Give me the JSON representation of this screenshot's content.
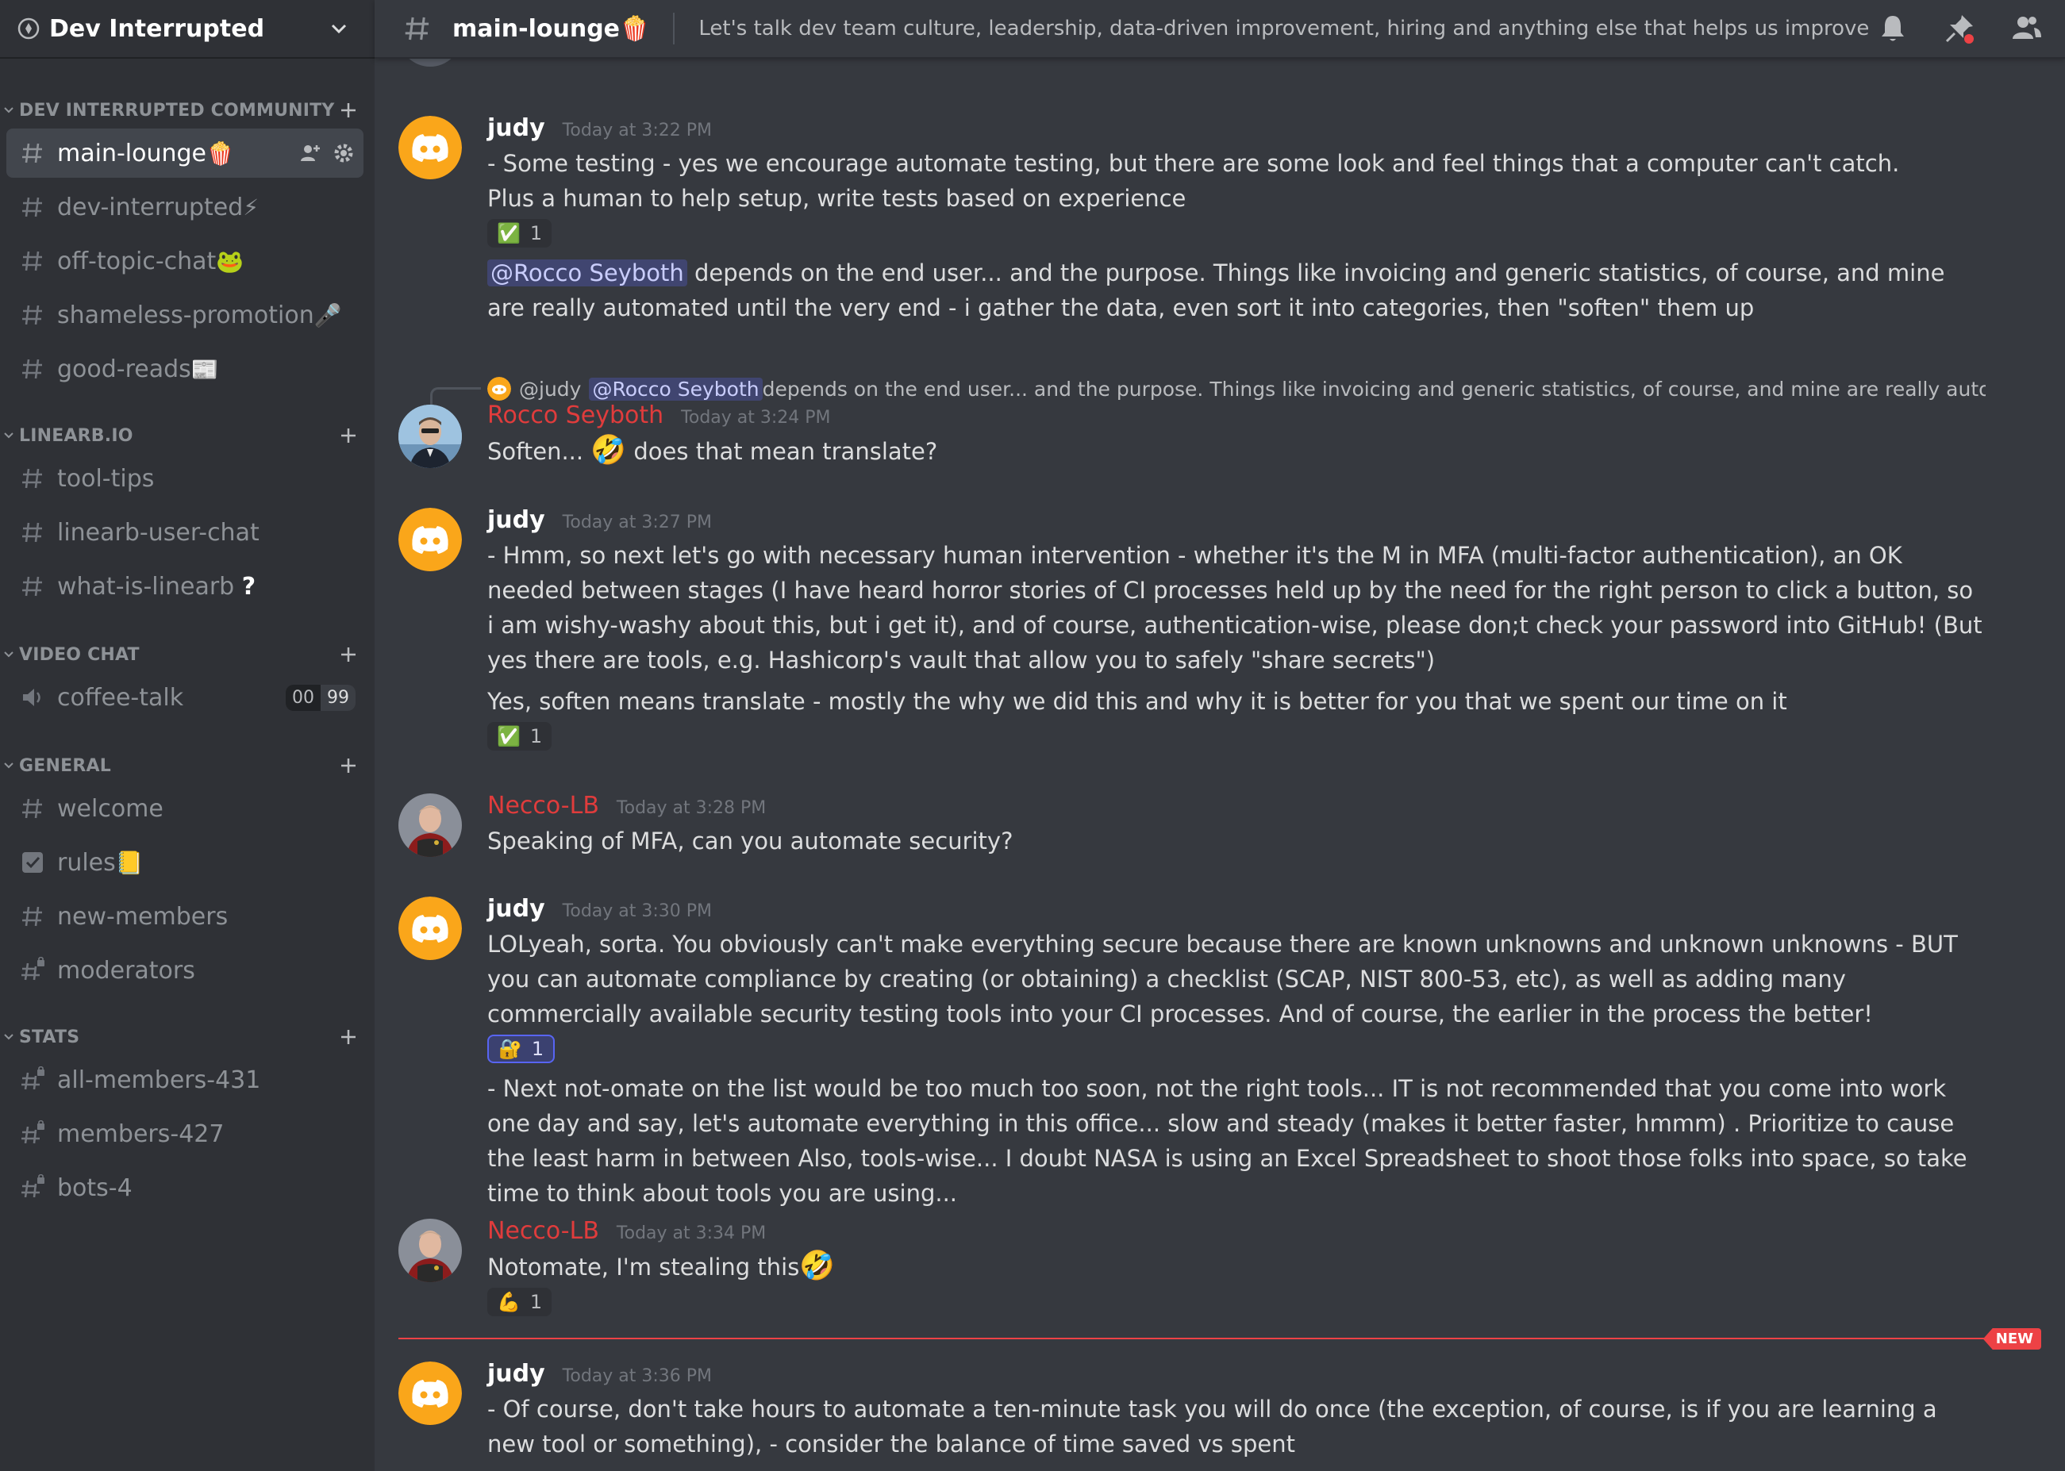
{
  "server": {
    "name": "Dev Interrupted"
  },
  "sidebar": {
    "categories": [
      {
        "name": "DEV INTERRUPTED COMMUNITY",
        "channels": [
          {
            "name": "main-lounge",
            "emoji": "🍿"
          },
          {
            "name": "dev-interrupted",
            "emoji": "⚡"
          },
          {
            "name": "off-topic-chat",
            "emoji": "🐸"
          },
          {
            "name": "shameless-promotion",
            "emoji": "🎤"
          },
          {
            "name": "good-reads",
            "emoji": "📰"
          }
        ]
      },
      {
        "name": "LINEARB.IO",
        "channels": [
          {
            "name": "tool-tips"
          },
          {
            "name": "linearb-user-chat"
          },
          {
            "name": "what-is-linearb",
            "suffix": "?"
          }
        ]
      },
      {
        "name": "VIDEO CHAT",
        "channels": [
          {
            "name": "coffee-talk",
            "count_a": "00",
            "count_b": "99"
          }
        ]
      },
      {
        "name": "GENERAL",
        "channels": [
          {
            "name": "welcome"
          },
          {
            "name": "rules",
            "emoji": "📒"
          },
          {
            "name": "new-members"
          },
          {
            "name": "moderators"
          }
        ]
      },
      {
        "name": "STATS",
        "channels": [
          {
            "name": "all-members-431"
          },
          {
            "name": "members-427"
          },
          {
            "name": "bots-4"
          }
        ]
      }
    ]
  },
  "header": {
    "channel": "main-lounge🍿",
    "topic": "Let's talk dev team culture, leadership, data-driven improvement, hiring and anything else that helps us improve as a community."
  },
  "colors": {
    "accent": "#5865f2",
    "mention_red": "#ed4245",
    "discord_yellow": "#faa61a",
    "username_red": "#e03c3c"
  },
  "messages": [
    {
      "author": "judy",
      "time": "Today at 3:22 PM",
      "lines": [
        "- Some testing - yes we encourage automate testing, but there are some look and feel things that a computer can't catch.",
        "Plus a human to help setup, write tests based on experience"
      ],
      "reaction": {
        "emoji": "✅",
        "count": "1"
      },
      "extra_mention": "@Rocco Seyboth",
      "extra_text": " depends on the end user... and the purpose.  Things like invoicing and generic statistics, of course, and mine are really automated until the very end - i gather the data, even sort it into categories, then \"soften\" them up"
    },
    {
      "reply": {
        "user": "@judy",
        "mention": "@Rocco Seyboth",
        "text": " depends on the end user... and the purpose.  Things like invoicing and generic statistics, of course, and mine are really automated un..."
      },
      "author": "Rocco Seyboth",
      "time": "Today at 3:24 PM",
      "text_a": "Soften... ",
      "emoji": "🤣",
      "text_b": " does that mean translate?"
    },
    {
      "author": "judy",
      "time": "Today at 3:27 PM",
      "text": "- Hmm, so next let's go with necessary human intervention - whether it's the M in MFA (multi-factor authentication), an OK needed between stages (I have heard horror stories of CI processes held up by the need for the right person to click a button, so i am wishy-washy about this, but i get it), and of course, authentication-wise, please don;t check your password into GitHub! (But yes there are tools, e.g. Hashicorp's vault that allow you to safely \"share secrets\")",
      "text2": "Yes, soften means translate - mostly the why we did this and why it is better for you that we spent our time on it",
      "reaction": {
        "emoji": "✅",
        "count": "1"
      }
    },
    {
      "author": "Necco-LB",
      "time": "Today at 3:28 PM",
      "text": "Speaking of MFA, can you automate security?"
    },
    {
      "author": "judy",
      "time": "Today at 3:30 PM",
      "text": "LOLyeah, sorta. You obviously can't make everything secure because there are known unknowns and unknown unknowns - BUT you can automate compliance by creating (or obtaining) a checklist (SCAP, NIST 800-53, etc), as well as adding many commercially available security testing tools into your CI processes.  And of course, the earlier in the process the better!",
      "reaction": {
        "emoji": "🔐",
        "count": "1"
      },
      "text2": "- Next not-omate on the list would be too much too soon, not the right tools... IT is not recommended that you come into work one day and say, let's automate everything  in this office... slow and steady (makes it better faster, hmmm) . Prioritize to cause the least harm in between Also, tools-wise... I doubt NASA is using an Excel Spreadsheet to shoot those folks into space, so take time to think about tools you are using..."
    },
    {
      "author": "Necco-LB",
      "time": "Today at 3:34 PM",
      "text": "Notomate, I'm stealing this",
      "emoji": "🤣",
      "reaction": {
        "emoji": "💪",
        "count": "1"
      }
    },
    {
      "author": "judy",
      "time": "Today at 3:36 PM",
      "text": "- Of course, don't take hours to automate a ten-minute task you will do once (the exception, of course, is if you are learning a new tool or something), - consider the balance of time saved vs spent"
    }
  ],
  "new_badge": "NEW"
}
